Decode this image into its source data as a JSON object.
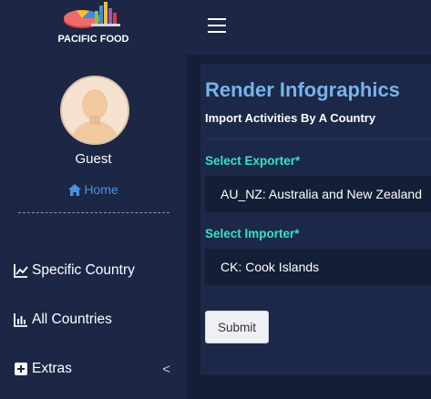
{
  "brand": {
    "name": "PACIFIC FOOD"
  },
  "user": {
    "name": "Guest",
    "home_label": "Home"
  },
  "nav": {
    "items": [
      {
        "label": "Specific Country",
        "icon": "line-chart-icon"
      },
      {
        "label": "All Countries",
        "icon": "bar-chart-icon"
      },
      {
        "label": "Extras",
        "icon": "plus-square-icon",
        "chevron": "<"
      }
    ]
  },
  "main": {
    "title": "Render Infographics",
    "subtitle": "Import Activities By A Country",
    "exporter": {
      "label": "Select Exporter*",
      "value": "AU_NZ: Australia and New Zealand"
    },
    "importer": {
      "label": "Select Importer*",
      "value": "CK: Cook Islands"
    },
    "submit_label": "Submit"
  },
  "colors": {
    "sidebar_bg": "#1b2745",
    "content_bg": "#141e36",
    "title": "#77b3ea",
    "field_label": "#33e3c6",
    "home_link": "#4a90e2"
  }
}
